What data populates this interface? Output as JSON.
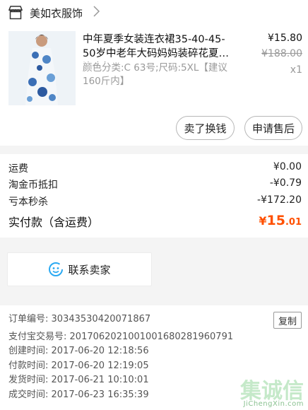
{
  "shop": {
    "name": "美如衣服饰"
  },
  "item": {
    "title": "中年夏季女装连衣裙35-40-45-50岁中老年大码妈妈装碎花夏装连衣裙",
    "spec": "颜色分类:C 63号;尺码:5XL【建议160斤内】",
    "price": "¥15.80",
    "original_price": "¥188.00",
    "quantity": "x1",
    "buttons": {
      "refund": "卖了换钱",
      "after_sales": "申请售后"
    }
  },
  "fees": [
    {
      "label": "运费",
      "value": "¥0.00"
    },
    {
      "label": "淘金币抵扣",
      "value": "-¥0.79"
    },
    {
      "label": "亏本秒杀",
      "value": "-¥172.20"
    }
  ],
  "total": {
    "label": "实付款（含运费）",
    "currency": "¥",
    "integer": "15",
    "decimal": ".01"
  },
  "contact": {
    "label": "联系卖家"
  },
  "order": {
    "copy_label": "复制",
    "rows": [
      {
        "label": "订单编号:",
        "value": "30343530420071867"
      },
      {
        "label": "支付宝交易号:",
        "value": "2017062021001001680281960791"
      },
      {
        "label": "创建时间:",
        "value": "2017-06-20 12:18:56"
      },
      {
        "label": "付款时间:",
        "value": "2017-06-20 12:19:05"
      },
      {
        "label": "发货时间:",
        "value": "2017-06-21 10:10:01"
      },
      {
        "label": "成交时间:",
        "value": "2017-06-23 16:35:39"
      }
    ]
  },
  "watermark": {
    "chars": "集诚信",
    "domain": "JiChengXin.com"
  },
  "colors": {
    "accent": "#ff5000",
    "contact_icon": "#2aa9f2"
  }
}
